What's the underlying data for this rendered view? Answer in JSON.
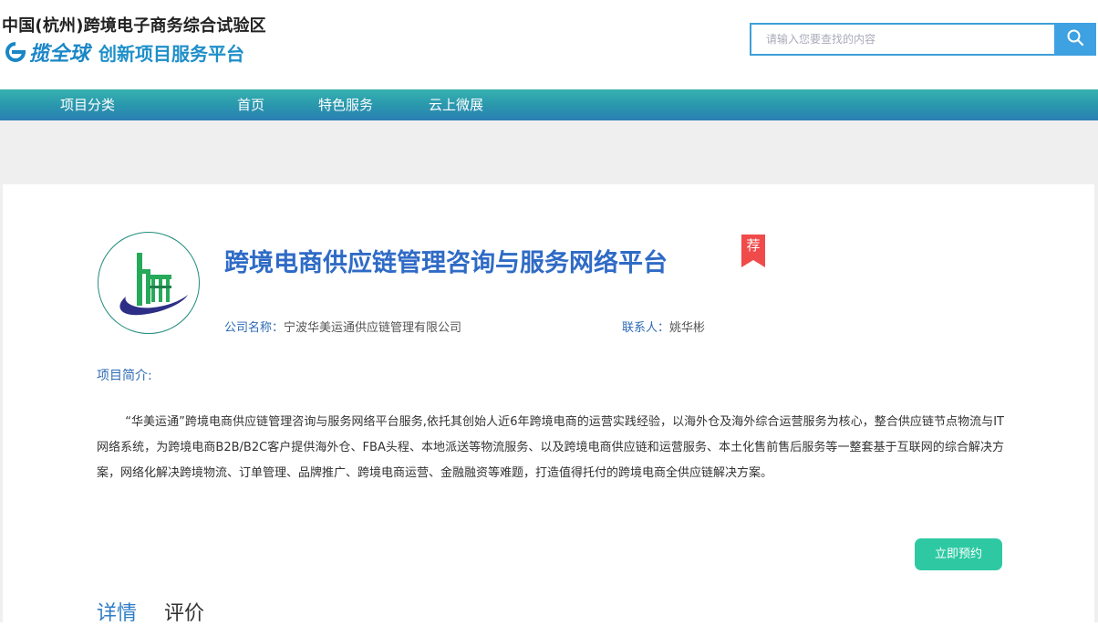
{
  "header": {
    "logo_top": "中国(杭州)跨境电子商务综合试验区",
    "logo_brand": "揽全球",
    "logo_sub": "创新项目服务平台"
  },
  "search": {
    "placeholder": "请输入您要查找的内容"
  },
  "nav": {
    "items": [
      {
        "label": "项目分类"
      },
      {
        "label": "首页"
      },
      {
        "label": "特色服务"
      },
      {
        "label": "云上微展"
      }
    ]
  },
  "project": {
    "title": "跨境电商供应链管理咨询与服务网络平台",
    "badge": "荐",
    "company_label": "公司名称：",
    "company_name": "宁波华美运通供应链管理有限公司",
    "contact_label": "联系人：",
    "contact_name": "姚华彬",
    "intro_heading": "项目简介:",
    "intro_text": "“华美运通”跨境电商供应链管理咨询与服务网络平台服务,依托其创始人近6年跨境电商的运营实践经验，以海外仓及海外综合运营服务为核心，整合供应链节点物流与IT网络系统，为跨境电商B2B/B2C客户提供海外仓、FBA头程、本地派送等物流服务、以及跨境电商供应链和运营服务、本土化售前售后服务等一整套基于互联网的综合解决方案，网络化解决跨境物流、订单管理、品牌推广、跨境电商运营、金融融资等难题，打造值得托付的跨境电商全供应链解决方案。",
    "book_button": "立即预约"
  },
  "tabs": [
    {
      "label": "详情",
      "active": true
    },
    {
      "label": "评价",
      "active": false
    }
  ],
  "colors": {
    "accent": "#2f6bc6",
    "nav_start": "#36b2b0",
    "nav_end": "#2b7fb3",
    "book_button": "#2ec9a3",
    "badge": "#f04a4a",
    "search_button": "#3ea1e2"
  },
  "icons": {
    "search": "search-icon",
    "badge": "recommend-badge-icon"
  }
}
